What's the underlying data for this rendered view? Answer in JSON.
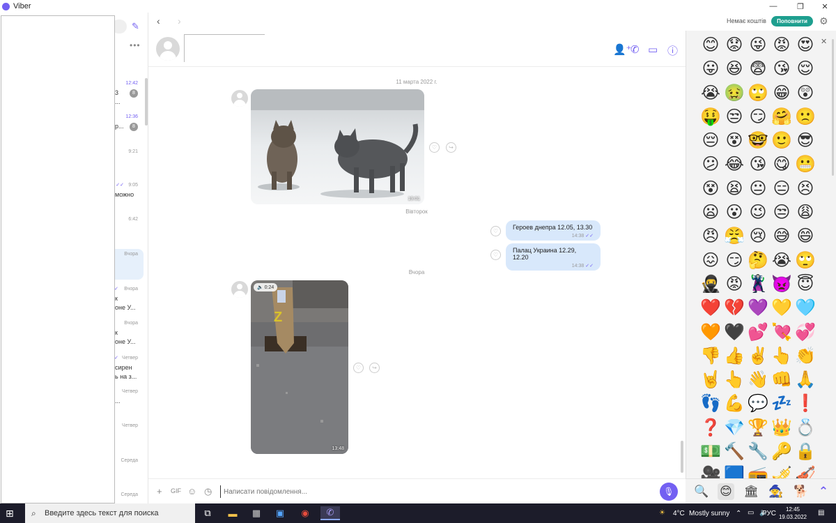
{
  "window": {
    "title": "Viber",
    "minimize": "—",
    "maximize": "❐",
    "close": "✕"
  },
  "topbar": {
    "back": "‹",
    "forward": "›",
    "no_funds": "Немає коштів",
    "topup_label": "Поповнити"
  },
  "chatlist": {
    "rows": [
      {
        "time": "12:42",
        "line1": "3",
        "line2": "...",
        "badge": "8",
        "accent": true
      },
      {
        "time": "12:36",
        "line1": "р...",
        "line2": "",
        "badge": "8",
        "accent": true
      },
      {
        "time": "9:21",
        "line1": "",
        "line2": ""
      },
      {
        "time": "9:05",
        "line1": "можно",
        "line2": "",
        "check": "✓✓"
      },
      {
        "time": "6:42",
        "line1": "",
        "line2": ""
      },
      {
        "time": "Вчора",
        "line1": "",
        "line2": "",
        "selected": true
      },
      {
        "time": "Вчора",
        "line1": "к",
        "line2": "оне У...",
        "check": "✓✓"
      },
      {
        "time": "Вчора",
        "line1": "к",
        "line2": "оне У..."
      },
      {
        "time": "Четвер",
        "line1": "сирен",
        "line2": "ь на з...",
        "check": "✓"
      },
      {
        "time": "Четвер",
        "line1": "...",
        "line2": ""
      },
      {
        "time": "Четвер",
        "line1": "",
        "line2": ""
      },
      {
        "time": "Середа",
        "line1": "",
        "line2": ""
      },
      {
        "time": "Середа",
        "line1": "",
        "line2": ""
      }
    ]
  },
  "messages": {
    "date1": "11 марта 2022 г.",
    "photo1_time": "19:01",
    "date2": "Вівторок",
    "out1": {
      "text": "Героев днепра 12.05, 13.30",
      "time": "14:38"
    },
    "out2": {
      "text": "Палац Украина 12.29, 12.20",
      "time": "14:38"
    },
    "date3": "Вчора",
    "video_duration": "0:24",
    "video_time": "13:48",
    "video_letter": "Z"
  },
  "composer": {
    "placeholder": "Написати повідомлення..."
  },
  "emoji": {
    "grid": [
      "😊",
      "😟",
      "😜",
      "😡",
      "😍",
      "😛",
      "😆",
      "😨",
      "😘",
      "😌",
      "😭",
      "🤢",
      "🙄",
      "😁",
      "😲",
      "🤑",
      "😒",
      "😏",
      "🤗",
      "🙁",
      "😔",
      "😵",
      "🤓",
      "🙂",
      "😎",
      "😕",
      "😂",
      "😘",
      "😋",
      "😬",
      "😵",
      "😫",
      "😐",
      "😑",
      "😣",
      "😦",
      "😮",
      "😉",
      "😒",
      "😩",
      "😠",
      "😤",
      "😢",
      "😅",
      "😄",
      "😖",
      "😏",
      "🤔",
      "😭",
      "🙄",
      "🥷",
      "😡",
      "🦹",
      "👿",
      "😇",
      "❤️",
      "💔",
      "💜",
      "💛",
      "🩵",
      "🧡",
      "🖤",
      "💕",
      "💘",
      "💞",
      "👎",
      "👍",
      "✌️",
      "👆",
      "👏",
      "🤘",
      "👆",
      "👋",
      "👊",
      "🙏",
      "👣",
      "💪",
      "💬",
      "💤",
      "❗",
      "❓",
      "💎",
      "🏆",
      "👑",
      "💍",
      "💵",
      "🔨",
      "🔧",
      "🔑",
      "🔒",
      "🎥",
      "🟦",
      "📻",
      "🎺",
      "🎻"
    ],
    "close": "✕",
    "tabs": [
      "🔍",
      "😊",
      "🏛",
      "🧙",
      "🐕",
      "⌃"
    ]
  },
  "taskbar": {
    "search_placeholder": "Введите здесь текст для поиска",
    "weather": "4°C",
    "weather_desc": "Mostly sunny",
    "lang": "РУС",
    "time": "12:45",
    "date": "19.03.2022"
  }
}
